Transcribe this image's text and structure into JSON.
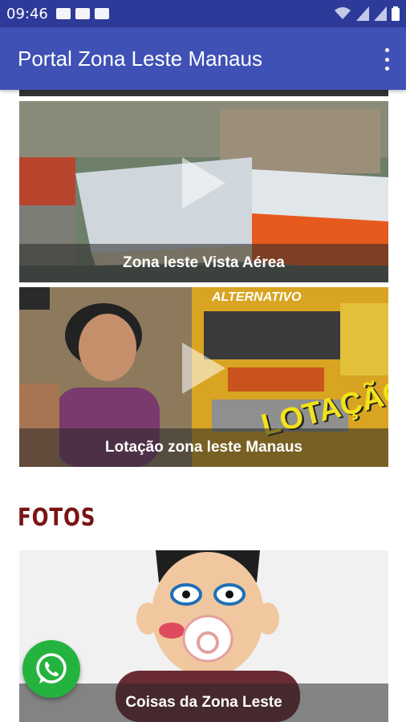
{
  "status_bar": {
    "time": "09:46",
    "icons_left": [
      "image-icon",
      "gallery-icon",
      "gallery-icon"
    ],
    "icons_right": [
      "wifi-icon",
      "signal-icon",
      "signal-icon",
      "battery-icon"
    ]
  },
  "app_bar": {
    "title": "Portal Zona Leste Manaus",
    "menu_icon": "overflow-menu-icon"
  },
  "videos": [
    {
      "caption": "Zona leste Vista Aérea"
    },
    {
      "caption": "Lotação zona leste Manaus",
      "overlay_text": "LOTAÇÃO",
      "bus_sign": "ALTERNATIVO"
    }
  ],
  "photos_section": {
    "title": "FOTOS",
    "items": [
      {
        "caption": "Coisas da Zona Leste"
      }
    ]
  },
  "fab": {
    "icon": "whatsapp-icon",
    "color": "#25b33f"
  },
  "colors": {
    "status_bar": "#2d3a9a",
    "app_bar": "#3f51b5",
    "section_title": "#7a1414"
  }
}
